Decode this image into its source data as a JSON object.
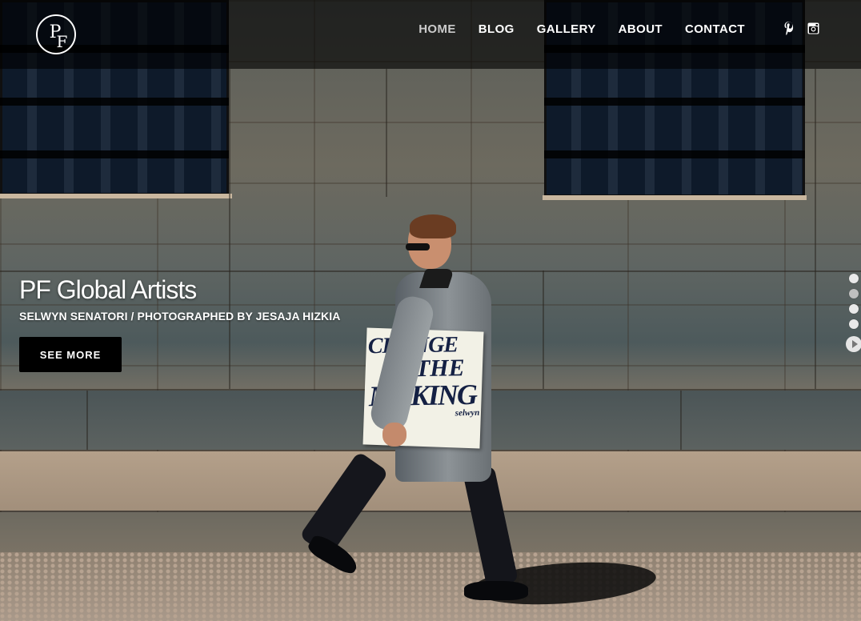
{
  "site": {
    "logo_text_1": "P",
    "logo_text_2": "F"
  },
  "nav": {
    "items": [
      {
        "label": "HOME",
        "active": true
      },
      {
        "label": "BLOG",
        "active": false
      },
      {
        "label": "GALLERY",
        "active": false
      },
      {
        "label": "ABOUT",
        "active": false
      },
      {
        "label": "CONTACT",
        "active": false
      }
    ],
    "social": [
      {
        "icon": "pinterest-icon",
        "glyph": "𝒑"
      },
      {
        "icon": "instagram-icon",
        "glyph": "◘"
      }
    ]
  },
  "hero": {
    "title": "PF Global Artists",
    "subtitle": "SELWYN SENATORI / PHOTOGRAPHED BY JESAJA HIZKIA",
    "button_label": "SEE MORE",
    "sign_lines": [
      "CHANGE",
      "IN THE",
      "MAKING",
      "selwyn"
    ]
  },
  "slider": {
    "slide_count": 4,
    "active_index": 1
  },
  "colors": {
    "navbar_bg": "#000000",
    "button_bg": "#000000",
    "text": "#ffffff"
  }
}
